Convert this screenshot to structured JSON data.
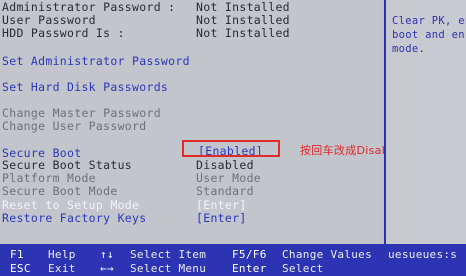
{
  "passwords_status": [
    {
      "label": "Administrator Password :",
      "value": "Not Installed"
    },
    {
      "label": "User Password",
      "value": "Not Installed"
    },
    {
      "label": "HDD Password Is :",
      "value": "Not Installed"
    }
  ],
  "menu": {
    "set_admin_password": "Set Administrator Password",
    "set_hdd_passwords": "Set Hard Disk Passwords",
    "change_master_password": "Change Master Password",
    "change_user_password": "Change User Password"
  },
  "secure_boot": [
    {
      "label": "Secure Boot",
      "value": "[Enabled]"
    },
    {
      "label": "Secure Boot Status",
      "value": "Disabled"
    },
    {
      "label": "Platform Mode",
      "value": "User Mode"
    },
    {
      "label": "Secure Boot Mode",
      "value": "Standard"
    },
    {
      "label": "Reset to Setup Mode",
      "value": "[Enter]"
    },
    {
      "label": "Restore Factory Keys",
      "value": "[Enter]"
    }
  ],
  "annotation": "按回车改成Disabled",
  "help_text": "Clear PK, en\nboot and en\nmode.",
  "footer": {
    "k1": "F1",
    "d1": "Help",
    "k2": "↑↓",
    "d2": "Select Item",
    "k3": "F5/F6",
    "d3": "Change Values",
    "k4": "ESC",
    "d4": "Exit",
    "k5": "←→",
    "d5": "Select Menu",
    "k6": "Enter",
    "d6": "Select",
    "extra": "uesueues:s"
  },
  "colors": {
    "accent_blue": "#2c37b8",
    "highlight_red": "#e12b2b",
    "footer_bg": "#2d34b4"
  }
}
